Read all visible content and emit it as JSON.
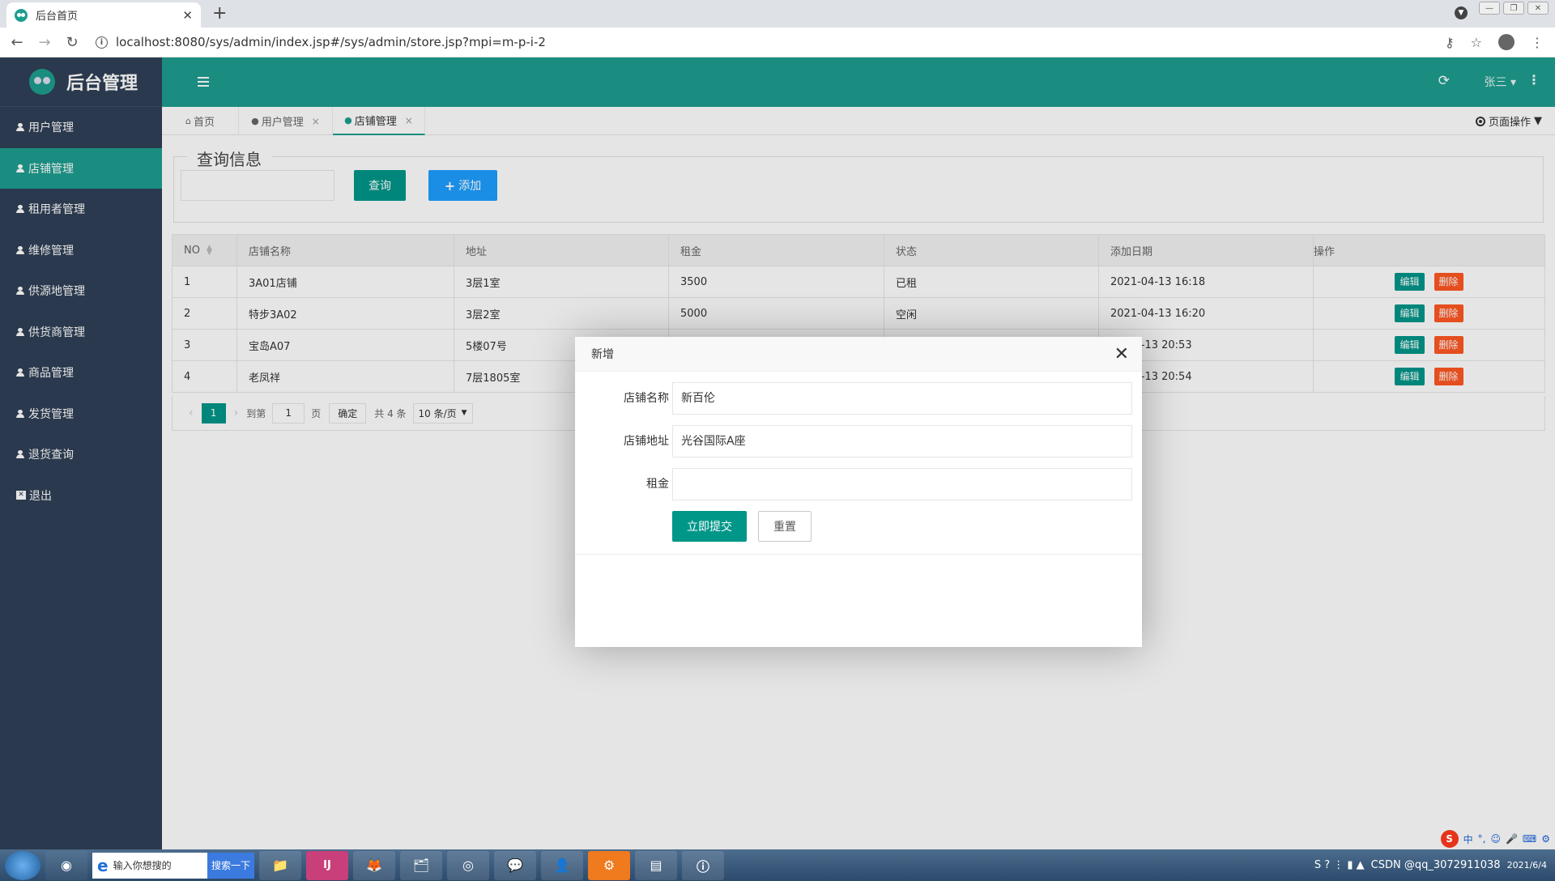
{
  "browser": {
    "tab_title": "后台首页",
    "url": "localhost:8080/sys/admin/index.jsp#/sys/admin/store.jsp?mpi=m-p-i-2"
  },
  "sidebar": {
    "logo_text": "后台管理",
    "items": [
      {
        "label": "用户管理",
        "icon": "user-icon",
        "active": false
      },
      {
        "label": "店铺管理",
        "icon": "user-icon",
        "active": true
      },
      {
        "label": "租用者管理",
        "icon": "user-icon",
        "active": false
      },
      {
        "label": "维修管理",
        "icon": "user-icon",
        "active": false
      },
      {
        "label": "供源地管理",
        "icon": "user-icon",
        "active": false
      },
      {
        "label": "供货商管理",
        "icon": "user-icon",
        "active": false
      },
      {
        "label": "商品管理",
        "icon": "user-icon",
        "active": false
      },
      {
        "label": "发货管理",
        "icon": "user-icon",
        "active": false
      },
      {
        "label": "退货查询",
        "icon": "user-icon",
        "active": false
      },
      {
        "label": "退出",
        "icon": "exit-icon",
        "active": false
      }
    ]
  },
  "header": {
    "user_name": "张三"
  },
  "page_tabs": [
    {
      "label": "首页",
      "icon": "home-icon"
    },
    {
      "label": "用户管理",
      "icon": "user-icon",
      "close": "×"
    },
    {
      "label": "店铺管理",
      "icon": "user-icon",
      "close": "×",
      "active": true
    }
  ],
  "page_ops_label": "页面操作",
  "query": {
    "legend": "查询信息",
    "search_button": "查询",
    "add_button": "添加"
  },
  "table": {
    "headers": [
      "NO",
      "店铺名称",
      "地址",
      "租金",
      "状态",
      "添加日期",
      "操作"
    ],
    "rows": [
      {
        "no": "1",
        "name": "3A01店铺",
        "address": "3层1室",
        "rent": "3500",
        "status": "已租",
        "date": "2021-04-13 16:18"
      },
      {
        "no": "2",
        "name": "特步3A02",
        "address": "3层2室",
        "rent": "5000",
        "status": "空闲",
        "date": "2021-04-13 16:20"
      },
      {
        "no": "3",
        "name": "宝岛A07",
        "address": "5楼07号",
        "rent": "",
        "status": "",
        "date": "21-04-13 20:53"
      },
      {
        "no": "4",
        "name": "老凤祥",
        "address": "7层1805室",
        "rent": "",
        "status": "",
        "date": "21-04-13 20:54"
      }
    ],
    "edit_label": "编辑",
    "delete_label": "删除"
  },
  "pager": {
    "current": "1",
    "goto_label": "到第",
    "goto_value": "1",
    "page_unit": "页",
    "confirm": "确定",
    "total": "共 4 条",
    "page_size": "10 条/页"
  },
  "modal": {
    "title": "新增",
    "fields": [
      {
        "label": "店铺名称",
        "value": "新百伦"
      },
      {
        "label": "店铺地址",
        "value": "光谷国际A座"
      },
      {
        "label": "租金",
        "value": ""
      }
    ],
    "submit": "立即提交",
    "reset": "重置"
  },
  "taskbar": {
    "search_placeholder": "输入你想搜的",
    "search_button": "搜索一下",
    "watermark": "CSDN @qq_3072911038",
    "date": "2021/6/4"
  },
  "colors": {
    "sidebar_bg": "#2f4056",
    "accent": "#1e9e8f",
    "primary_button": "#009688",
    "add_button": "#1e9fff",
    "delete_button": "#ff5722"
  }
}
